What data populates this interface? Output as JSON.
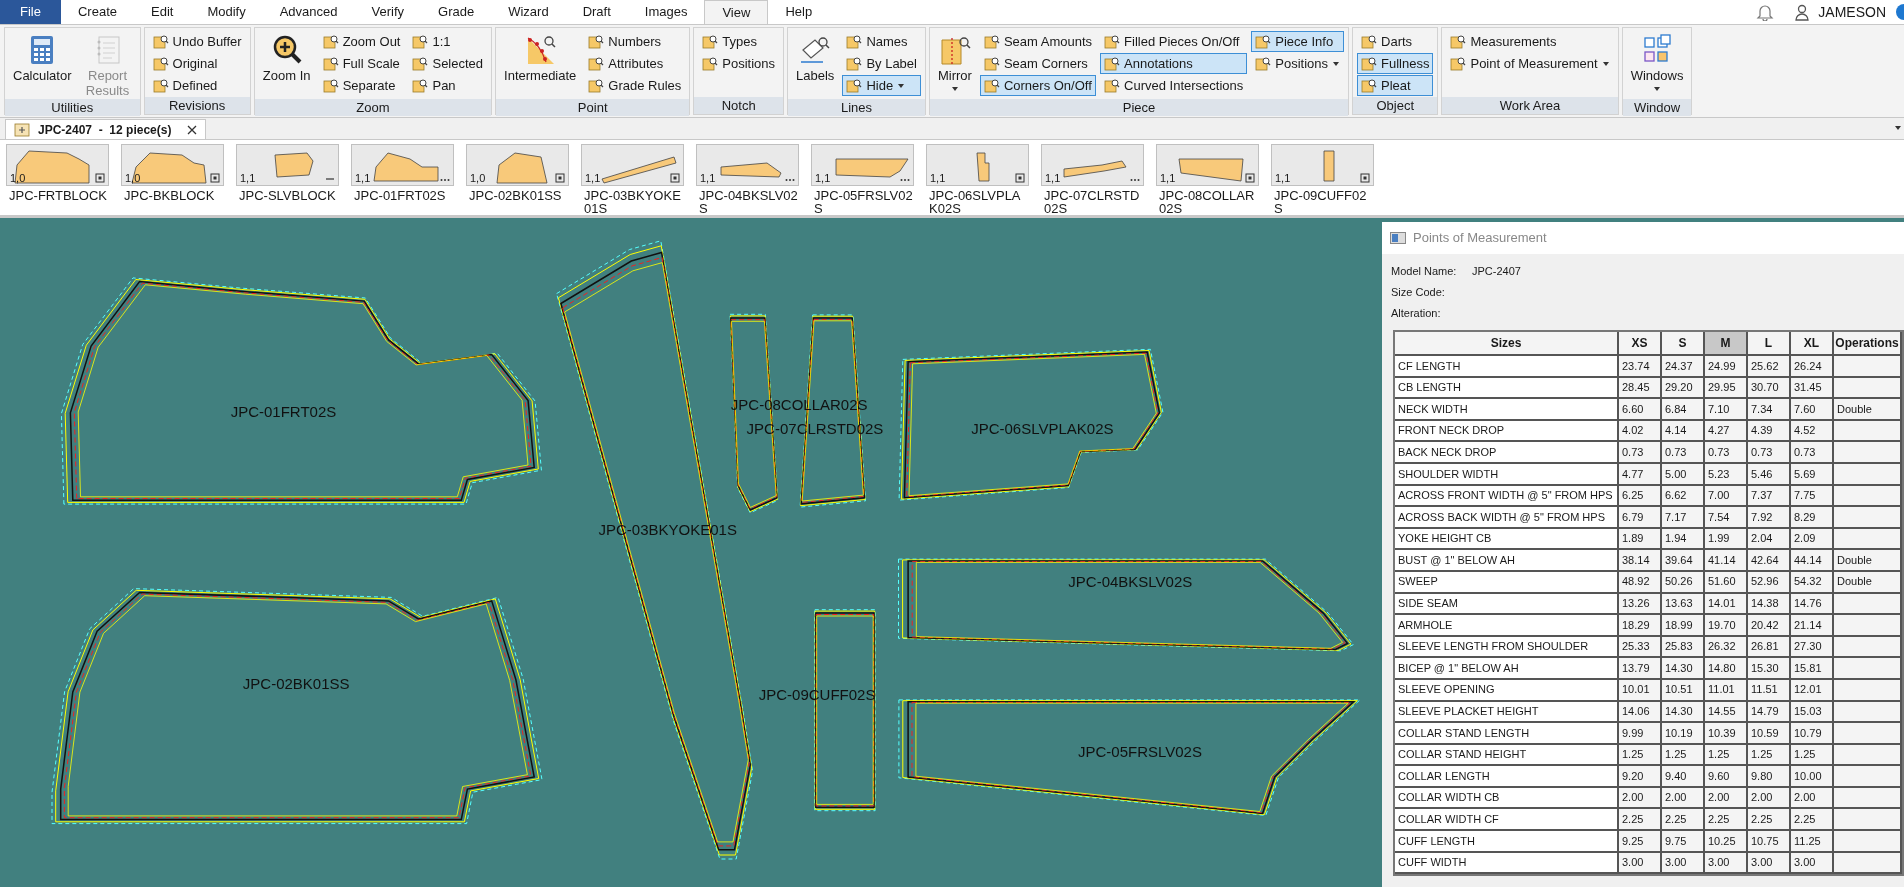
{
  "menu_tabs": [
    {
      "label": "File",
      "kind": "file",
      "selected": false
    },
    {
      "label": "Create",
      "kind": "tab",
      "selected": false
    },
    {
      "label": "Edit",
      "kind": "tab",
      "selected": false
    },
    {
      "label": "Modify",
      "kind": "tab",
      "selected": false
    },
    {
      "label": "Advanced",
      "kind": "tab",
      "selected": false
    },
    {
      "label": "Verify",
      "kind": "tab",
      "selected": false
    },
    {
      "label": "Grade",
      "kind": "tab",
      "selected": false
    },
    {
      "label": "Wizard",
      "kind": "tab",
      "selected": false
    },
    {
      "label": "Draft",
      "kind": "tab",
      "selected": false
    },
    {
      "label": "Images",
      "kind": "tab",
      "selected": false
    },
    {
      "label": "View",
      "kind": "tab",
      "selected": true
    },
    {
      "label": "Help",
      "kind": "tab",
      "selected": false
    }
  ],
  "user": {
    "name": "JAMESON"
  },
  "ribbon": [
    {
      "title": "Utilities",
      "items": [
        {
          "label": "Calculator",
          "kind": "large",
          "on": false,
          "disabled": false
        },
        {
          "label": "Report Results",
          "kind": "large",
          "on": false,
          "disabled": true
        }
      ]
    },
    {
      "title": "Revisions",
      "items": [
        {
          "label": "Undo Buffer",
          "kind": "small",
          "on": false,
          "disabled": false
        },
        {
          "label": "Original",
          "kind": "small",
          "on": false,
          "disabled": false
        },
        {
          "label": "Defined",
          "kind": "small",
          "on": false,
          "disabled": false
        }
      ]
    },
    {
      "title": "Zoom",
      "items": [
        {
          "label": "Zoom In",
          "kind": "large",
          "on": false,
          "disabled": false
        },
        {
          "label": "Zoom Out",
          "kind": "small",
          "on": false,
          "disabled": false
        },
        {
          "label": "Full Scale",
          "kind": "small",
          "on": false,
          "disabled": false
        },
        {
          "label": "Separate",
          "kind": "small",
          "on": false,
          "disabled": false
        },
        {
          "label": "1:1",
          "kind": "small",
          "on": false,
          "disabled": false
        },
        {
          "label": "Selected",
          "kind": "small",
          "on": false,
          "disabled": false
        },
        {
          "label": "Pan",
          "kind": "small",
          "on": false,
          "disabled": false
        }
      ]
    },
    {
      "title": "Point",
      "items": [
        {
          "label": "Intermediate",
          "kind": "large",
          "on": false,
          "disabled": false
        },
        {
          "label": "Numbers",
          "kind": "small",
          "on": false,
          "disabled": false
        },
        {
          "label": "Attributes",
          "kind": "small",
          "on": false,
          "disabled": false
        },
        {
          "label": "Grade Rules",
          "kind": "small",
          "on": false,
          "disabled": false
        }
      ]
    },
    {
      "title": "Notch",
      "items": [
        {
          "label": "Types",
          "kind": "small",
          "on": false,
          "disabled": false
        },
        {
          "label": "Positions",
          "kind": "small",
          "on": false,
          "disabled": false
        }
      ]
    },
    {
      "title": "Lines",
      "items": [
        {
          "label": "Labels",
          "kind": "large",
          "on": false,
          "disabled": false
        },
        {
          "label": "Names",
          "kind": "small",
          "on": false,
          "disabled": false
        },
        {
          "label": "By Label",
          "kind": "small",
          "on": false,
          "disabled": false
        },
        {
          "label": "Hide",
          "kind": "small",
          "on": true,
          "disabled": false,
          "menu": true
        }
      ]
    },
    {
      "title": "Piece",
      "items": [
        {
          "label": "Mirror",
          "kind": "large",
          "on": false,
          "disabled": false,
          "menu": true
        },
        {
          "label": "Seam Amounts",
          "kind": "small",
          "on": false,
          "disabled": false
        },
        {
          "label": "Seam Corners",
          "kind": "small",
          "on": false,
          "disabled": false
        },
        {
          "label": "Corners On/Off",
          "kind": "small",
          "on": true,
          "disabled": false
        },
        {
          "label": "Filled Pieces On/Off",
          "kind": "small",
          "on": false,
          "disabled": false
        },
        {
          "label": "Annotations",
          "kind": "small",
          "on": true,
          "disabled": false
        },
        {
          "label": "Curved Intersections",
          "kind": "small",
          "on": false,
          "disabled": false
        },
        {
          "label": "Piece Info",
          "kind": "small",
          "on": true,
          "disabled": false
        },
        {
          "label": "Positions",
          "kind": "small",
          "on": false,
          "disabled": false,
          "menu": true
        }
      ]
    },
    {
      "title": "Object",
      "items": [
        {
          "label": "Darts",
          "kind": "small",
          "on": false,
          "disabled": false
        },
        {
          "label": "Fullness",
          "kind": "small",
          "on": true,
          "disabled": false
        },
        {
          "label": "Pleat",
          "kind": "small",
          "on": true,
          "disabled": false
        }
      ]
    },
    {
      "title": "Work Area",
      "items": [
        {
          "label": "Measurements",
          "kind": "small",
          "on": false,
          "disabled": false
        },
        {
          "label": "Point of Measurement",
          "kind": "small",
          "on": false,
          "disabled": false,
          "menu": true
        }
      ]
    },
    {
      "title": "Window",
      "items": [
        {
          "label": "Windows",
          "kind": "large",
          "on": false,
          "disabled": false,
          "menu": true
        }
      ]
    }
  ],
  "document_tab": {
    "label": "JPC-2407  -  12 piece(s)"
  },
  "thumbnails": [
    {
      "name": "JPC-FRTBLOCK",
      "grade": "1,0",
      "kind": "box"
    },
    {
      "name": "JPC-BKBLOCK",
      "grade": "1,0",
      "kind": "box"
    },
    {
      "name": "JPC-SLVBLOCK",
      "grade": "1,1",
      "kind": "dash"
    },
    {
      "name": "JPC-01FRT02S",
      "grade": "1,1",
      "kind": "dots"
    },
    {
      "name": "JPC-02BK01SS",
      "grade": "1,0",
      "kind": "box"
    },
    {
      "name": "JPC-03BKYOKE01S",
      "grade": "1,1",
      "kind": "box"
    },
    {
      "name": "JPC-04BKSLV02S",
      "grade": "1,1",
      "kind": "dots"
    },
    {
      "name": "JPC-05FRSLV02S",
      "grade": "1,1",
      "kind": "dots"
    },
    {
      "name": "JPC-06SLVPLAK02S",
      "grade": "1,1",
      "kind": "box"
    },
    {
      "name": "JPC-07CLRSTD02S",
      "grade": "1,1",
      "kind": "dots"
    },
    {
      "name": "JPC-08COLLAR02S",
      "grade": "1,1",
      "kind": "box"
    },
    {
      "name": "JPC-09CUFF02S",
      "grade": "1,1",
      "kind": "box"
    }
  ],
  "canvas": {
    "piece_labels": [
      "JPC-01FRT02S",
      "JPC-08COLLAR02S",
      "JPC-07CLRSTD02S",
      "JPC-06SLVPLAK02S",
      "JPC-03BKYOKE01S",
      "JPC-04BKSLV02S",
      "JPC-02BK01SS",
      "JPC-09CUFF02S",
      "JPC-05FRSLV02S"
    ]
  },
  "pom_panel": {
    "title": "Points of Measurement",
    "fields": [
      {
        "label": "Model Name:",
        "value": "JPC-2407"
      },
      {
        "label": "Size Code:"
      },
      {
        "label": "Alteration:"
      }
    ],
    "columns": [
      {
        "label": "Sizes",
        "selected": false
      },
      {
        "label": "XS",
        "selected": false
      },
      {
        "label": "S",
        "selected": false
      },
      {
        "label": "M",
        "selected": true
      },
      {
        "label": "L",
        "selected": false
      },
      {
        "label": "XL",
        "selected": false
      },
      {
        "label": "Operations",
        "selected": false
      }
    ],
    "rows": [
      [
        "CF LENGTH",
        "23.74",
        "24.37",
        "24.99",
        "25.62",
        "26.24",
        ""
      ],
      [
        "CB LENGTH",
        "28.45",
        "29.20",
        "29.95",
        "30.70",
        "31.45",
        ""
      ],
      [
        "NECK WIDTH",
        "6.60",
        "6.84",
        "7.10",
        "7.34",
        "7.60",
        "Double"
      ],
      [
        "FRONT NECK DROP",
        "4.02",
        "4.14",
        "4.27",
        "4.39",
        "4.52",
        ""
      ],
      [
        "BACK NECK DROP",
        "0.73",
        "0.73",
        "0.73",
        "0.73",
        "0.73",
        ""
      ],
      [
        "SHOULDER WIDTH",
        "4.77",
        "5.00",
        "5.23",
        "5.46",
        "5.69",
        ""
      ],
      [
        "ACROSS FRONT WIDTH @ 5\" FROM HPS",
        "6.25",
        "6.62",
        "7.00",
        "7.37",
        "7.75",
        ""
      ],
      [
        "ACROSS BACK WIDTH @ 5\" FROM HPS",
        "6.79",
        "7.17",
        "7.54",
        "7.92",
        "8.29",
        ""
      ],
      [
        "YOKE HEIGHT CB",
        "1.89",
        "1.94",
        "1.99",
        "2.04",
        "2.09",
        ""
      ],
      [
        "BUST @ 1\" BELOW AH",
        "38.14",
        "39.64",
        "41.14",
        "42.64",
        "44.14",
        "Double"
      ],
      [
        "SWEEP",
        "48.92",
        "50.26",
        "51.60",
        "52.96",
        "54.32",
        "Double"
      ],
      [
        "SIDE SEAM",
        "13.26",
        "13.63",
        "14.01",
        "14.38",
        "14.76",
        ""
      ],
      [
        "ARMHOLE",
        "18.29",
        "18.99",
        "19.70",
        "20.42",
        "21.14",
        ""
      ],
      [
        "SLEEVE LENGTH FROM SHOULDER",
        "25.33",
        "25.83",
        "26.32",
        "26.81",
        "27.30",
        ""
      ],
      [
        "BICEP @ 1\" BELOW AH",
        "13.79",
        "14.30",
        "14.80",
        "15.30",
        "15.81",
        ""
      ],
      [
        "SLEEVE OPENING",
        "10.01",
        "10.51",
        "11.01",
        "11.51",
        "12.01",
        ""
      ],
      [
        "SLEEVE PLACKET HEIGHT",
        "14.06",
        "14.30",
        "14.55",
        "14.79",
        "15.03",
        ""
      ],
      [
        "COLLAR STAND LENGTH",
        "9.99",
        "10.19",
        "10.39",
        "10.59",
        "10.79",
        ""
      ],
      [
        "COLLAR STAND HEIGHT",
        "1.25",
        "1.25",
        "1.25",
        "1.25",
        "1.25",
        ""
      ],
      [
        "COLLAR LENGTH",
        "9.20",
        "9.40",
        "9.60",
        "9.80",
        "10.00",
        ""
      ],
      [
        "COLLAR WIDTH CB",
        "2.00",
        "2.00",
        "2.00",
        "2.00",
        "2.00",
        ""
      ],
      [
        "COLLAR WIDTH CF",
        "2.25",
        "2.25",
        "2.25",
        "2.25",
        "2.25",
        ""
      ],
      [
        "CUFF LENGTH",
        "9.25",
        "9.75",
        "10.25",
        "10.75",
        "11.25",
        ""
      ],
      [
        "CUFF WIDTH",
        "3.00",
        "3.00",
        "3.00",
        "3.00",
        "3.00",
        ""
      ]
    ]
  }
}
